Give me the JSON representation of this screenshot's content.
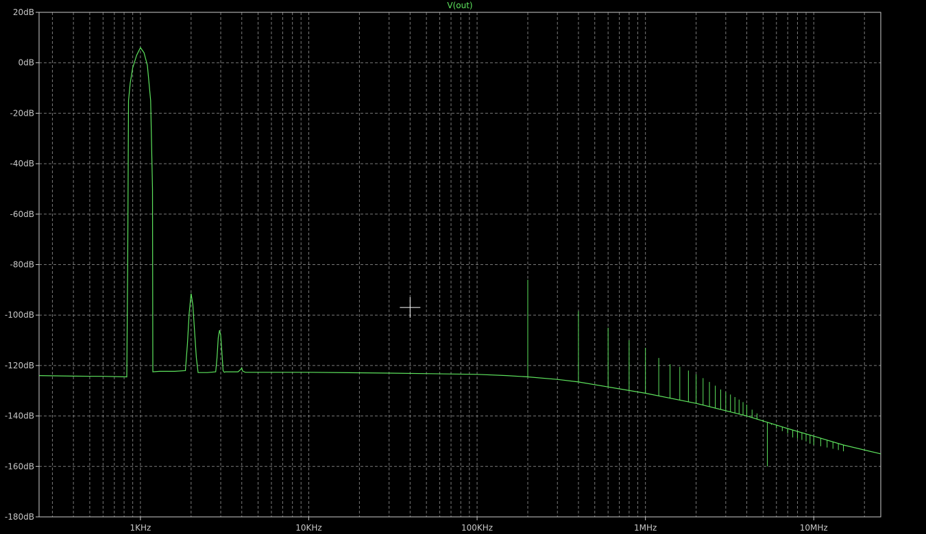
{
  "chart_data": {
    "type": "line",
    "title": "V(out)",
    "xlabel": "",
    "ylabel": "",
    "x_scale": "log",
    "xlim": [
      250,
      25000000
    ],
    "ylim": [
      -180,
      20
    ],
    "grid": true,
    "y_ticks": [
      {
        "value": 20,
        "label": "20dB"
      },
      {
        "value": 0,
        "label": "0dB"
      },
      {
        "value": -20,
        "label": "-20dB"
      },
      {
        "value": -40,
        "label": "-40dB"
      },
      {
        "value": -60,
        "label": "-60dB"
      },
      {
        "value": -80,
        "label": "-80dB"
      },
      {
        "value": -100,
        "label": "-100dB"
      },
      {
        "value": -120,
        "label": "-120dB"
      },
      {
        "value": -140,
        "label": "-140dB"
      },
      {
        "value": -160,
        "label": "-160dB"
      },
      {
        "value": -180,
        "label": "-180dB"
      }
    ],
    "x_ticks": [
      {
        "value": 1000,
        "label": "1KHz"
      },
      {
        "value": 10000,
        "label": "10KHz"
      },
      {
        "value": 100000,
        "label": "100KHz"
      },
      {
        "value": 1000000,
        "label": "1MHz"
      },
      {
        "value": 10000000,
        "label": "10MHz"
      }
    ],
    "series": [
      {
        "color": "#5ee55e",
        "x": [
          250,
          400,
          600,
          830,
          840,
          850,
          870,
          900,
          950,
          1000,
          1050,
          1100,
          1150,
          1180,
          1185,
          1300,
          1600,
          1850,
          1900,
          1950,
          2000,
          2050,
          2100,
          2150,
          2200,
          2500,
          2800,
          2850,
          2900,
          2950,
          3000,
          3050,
          3100,
          3150,
          3200,
          3800,
          3950,
          4000,
          4050,
          4200,
          5000,
          10000,
          30000,
          100000,
          150000,
          200000,
          300000,
          400000,
          600000,
          1000000,
          2000000,
          4000000,
          7000000,
          10000000,
          15000000,
          25000000
        ],
        "y": [
          -124,
          -124.2,
          -124.3,
          -124.5,
          -80,
          -15,
          -8,
          -2,
          3,
          6,
          4,
          -1,
          -15,
          -50,
          -122.5,
          -122.3,
          -122.3,
          -122,
          -112,
          -99,
          -91.5,
          -96,
          -107,
          -117,
          -122.8,
          -122.8,
          -122.5,
          -117,
          -109,
          -106,
          -108,
          -115,
          -122,
          -122.7,
          -122.5,
          -122.5,
          -121.5,
          -121,
          -122.2,
          -122.7,
          -122.7,
          -122.7,
          -123,
          -123.5,
          -124,
          -124.5,
          -125.5,
          -126.5,
          -128.5,
          -131,
          -135,
          -140,
          -145,
          -148,
          -151.5,
          -155
        ]
      }
    ],
    "spurs": {
      "x": [
        200000,
        400000,
        600000,
        800000,
        1000000,
        1200000,
        1400000,
        1600000,
        1800000,
        2000000,
        2200000,
        2400000,
        2600000,
        2800000,
        3000000,
        3200000,
        3400000,
        3600000,
        3800000,
        4000000,
        4300000,
        4600000,
        5000000,
        5300000,
        5600000,
        6000000,
        6500000,
        7000000,
        7500000,
        8000000,
        8500000,
        9000000,
        9500000,
        10000000,
        11000000,
        12000000,
        13000000,
        14000000,
        15000000
      ],
      "y": [
        -86,
        -98.5,
        -105,
        -110,
        -113,
        -117,
        -119.5,
        -120.5,
        -122,
        -123.5,
        -125,
        -126.5,
        -128,
        -129.5,
        -130.5,
        -131.5,
        -132.5,
        -133.5,
        -134.5,
        -135.5,
        -137.5,
        -139,
        -141.5,
        -160,
        -143.5,
        -145,
        -146,
        -147,
        -148.5,
        -149,
        -149.5,
        -150,
        -151,
        -151.5,
        -152,
        -152.5,
        -153,
        -153.5,
        -154
      ]
    },
    "cursor": {
      "x": 40000,
      "y": -97
    }
  }
}
